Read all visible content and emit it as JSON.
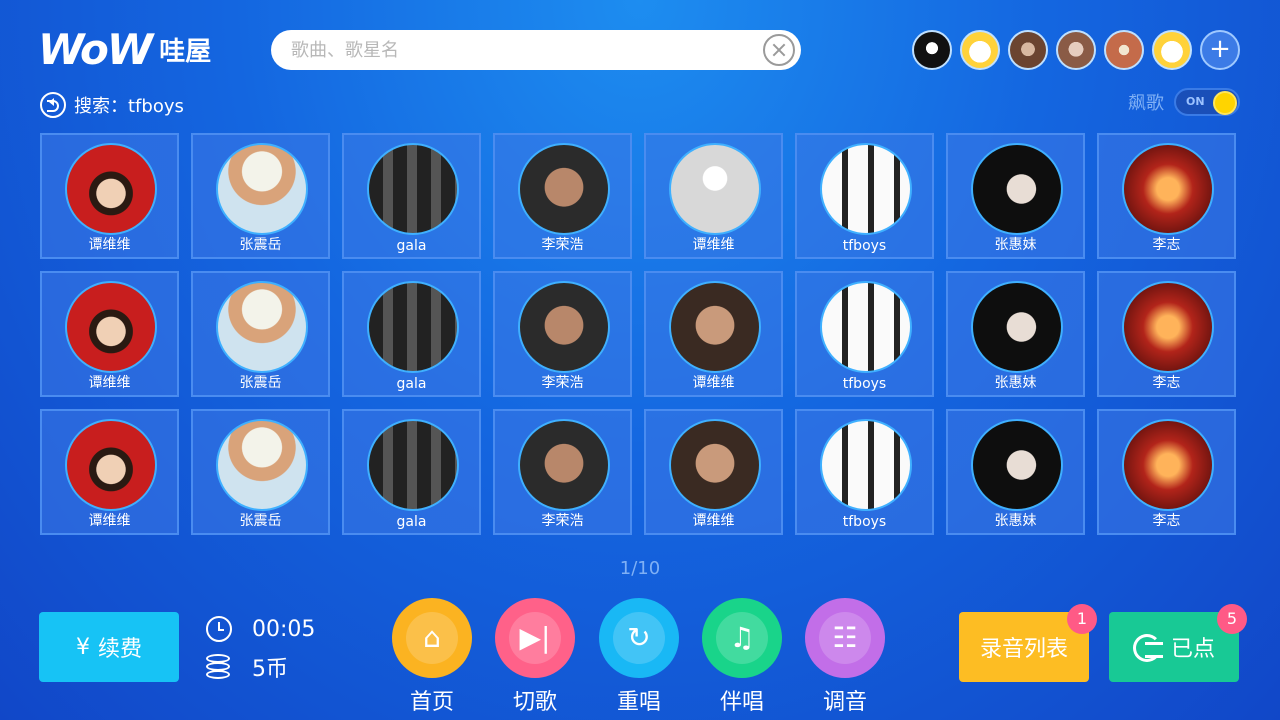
{
  "header": {
    "logo_text": "WoW",
    "logo_cn": "哇屋",
    "search_placeholder": "歌曲、歌星名",
    "users": [
      "avatar-1",
      "avatar-2",
      "avatar-3",
      "avatar-4",
      "avatar-5",
      "avatar-6"
    ],
    "add_user_label": "+"
  },
  "subheader": {
    "search_label": "搜索：tfboys",
    "toggle_label": "飙歌",
    "toggle_state": "ON"
  },
  "singers": [
    {
      "name": "谭维维",
      "style": "av-red"
    },
    {
      "name": "张震岳",
      "style": "av-hat"
    },
    {
      "name": "gala",
      "style": "av-band"
    },
    {
      "name": "李荣浩",
      "style": "av-man"
    },
    {
      "name": "谭维维",
      "style": "av-empty"
    },
    {
      "name": "tfboys",
      "style": "av-group"
    },
    {
      "name": "张惠妹",
      "style": "av-girl"
    },
    {
      "name": "李志",
      "style": "av-stage"
    },
    {
      "name": "谭维维",
      "style": "av-red"
    },
    {
      "name": "张震岳",
      "style": "av-hat"
    },
    {
      "name": "gala",
      "style": "av-band"
    },
    {
      "name": "李荣浩",
      "style": "av-man"
    },
    {
      "name": "谭维维",
      "style": "av-glass"
    },
    {
      "name": "tfboys",
      "style": "av-group"
    },
    {
      "name": "张惠妹",
      "style": "av-girl"
    },
    {
      "name": "李志",
      "style": "av-stage"
    },
    {
      "name": "谭维维",
      "style": "av-red"
    },
    {
      "name": "张震岳",
      "style": "av-hat"
    },
    {
      "name": "gala",
      "style": "av-band"
    },
    {
      "name": "李荣浩",
      "style": "av-man"
    },
    {
      "name": "谭维维",
      "style": "av-glass"
    },
    {
      "name": "tfboys",
      "style": "av-group"
    },
    {
      "name": "张惠妹",
      "style": "av-girl"
    },
    {
      "name": "李志",
      "style": "av-stage"
    }
  ],
  "pager": "1/10",
  "footer": {
    "renew_label": "续费",
    "renew_symbol": "¥",
    "time": "00:05",
    "coins": "5币",
    "actions": [
      {
        "label": "首页",
        "icon": "home-icon"
      },
      {
        "label": "切歌",
        "icon": "skip-icon"
      },
      {
        "label": "重唱",
        "icon": "replay-icon"
      },
      {
        "label": "伴唱",
        "icon": "accompany-icon"
      },
      {
        "label": "调音",
        "icon": "equalizer-icon"
      }
    ],
    "record_label": "录音列表",
    "record_badge": "1",
    "queue_label": "已点",
    "queue_badge": "5"
  },
  "colors": {
    "accent_yellow": "#fbb321",
    "accent_pink": "#ff6189",
    "accent_blue": "#19b8f5",
    "accent_green": "#19d48a",
    "accent_purple": "#c26ee8",
    "badge": "#ff5a86"
  }
}
